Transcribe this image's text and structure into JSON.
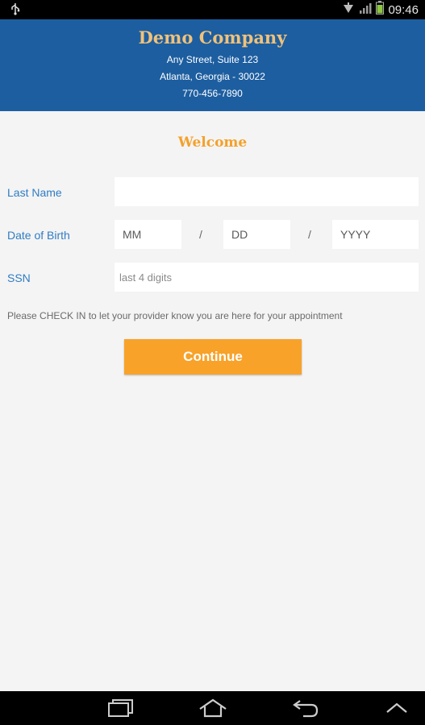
{
  "status_bar": {
    "time": "09:46",
    "icons": [
      "usb-icon",
      "wifi-icon",
      "signal-icon",
      "battery-icon"
    ]
  },
  "header": {
    "company_name": "Demo Company",
    "address_line1": "Any Street, Suite 123",
    "address_line2": "Atlanta, Georgia - 30022",
    "phone": "770-456-7890"
  },
  "welcome": "Welcome",
  "form": {
    "last_name_label": "Last Name",
    "last_name_value": "",
    "dob_label": "Date of Birth",
    "dob_month_placeholder": "MM",
    "dob_day_placeholder": "DD",
    "dob_year_placeholder": "YYYY",
    "separator": "/",
    "ssn_label": "SSN",
    "ssn_placeholder": "last 4 digits"
  },
  "note": "Please CHECK IN to let your provider know you are here for your appointment",
  "continue_label": "Continue",
  "nav_bar": {
    "icons": [
      "recent-apps-icon",
      "home-icon",
      "back-icon",
      "menu-up-icon"
    ]
  },
  "colors": {
    "header_bg": "#1d5ea0",
    "company_name": "#f0c27a",
    "accent": "#f8a22a",
    "label": "#2f7cc4"
  }
}
